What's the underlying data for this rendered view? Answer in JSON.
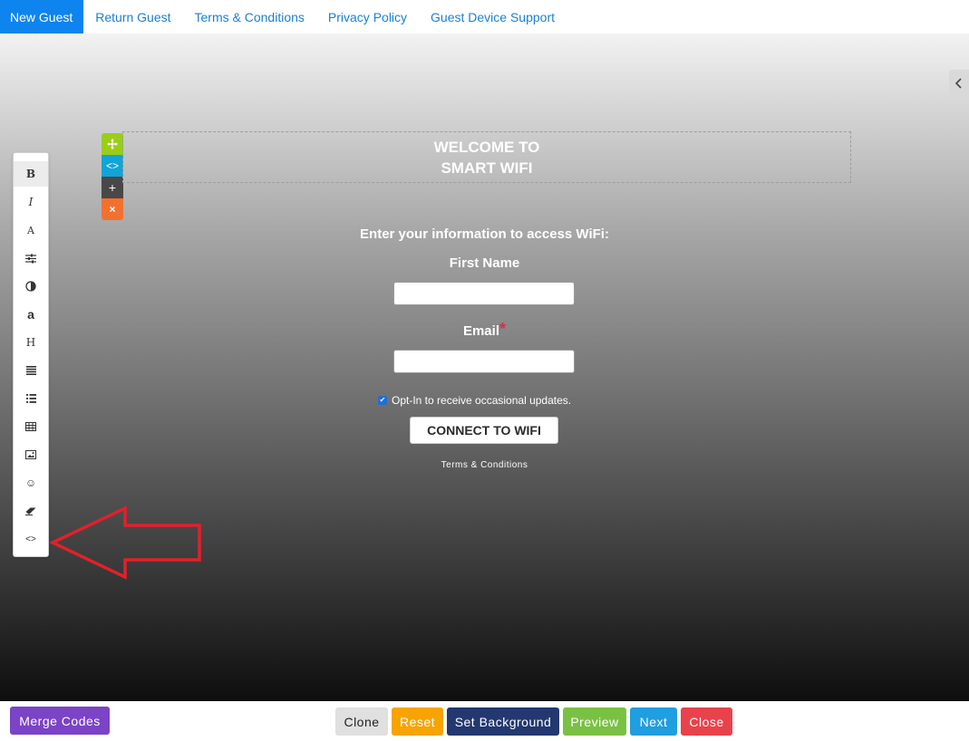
{
  "tabs": [
    {
      "label": "New Guest",
      "active": true
    },
    {
      "label": "Return Guest"
    },
    {
      "label": "Terms & Conditions"
    },
    {
      "label": "Privacy Policy"
    },
    {
      "label": "Guest Device Support"
    }
  ],
  "title": {
    "line1": "WELCOME TO",
    "line2": "SMART WIFI"
  },
  "form": {
    "prompt": "Enter your information to access WiFi:",
    "first_name_label": "First Name",
    "first_name_value": "",
    "email_label": "Email",
    "email_required_mark": "*",
    "email_value": "",
    "optin_label": "Opt-In to receive occasional updates.",
    "optin_checked": true,
    "connect_label": "CONNECT TO WIFI",
    "terms_label": "Terms & Conditions"
  },
  "block_controls": [
    "move-icon",
    "code-icon",
    "add-icon",
    "delete-icon"
  ],
  "toolbar_tools": [
    "bold",
    "italic",
    "font",
    "adjust",
    "contrast",
    "font-size",
    "heading",
    "align",
    "list",
    "table",
    "image",
    "emoji",
    "eraser",
    "code-view"
  ],
  "bottom_buttons": {
    "merge_codes": "Merge Codes",
    "clone": "Clone",
    "reset": "Reset",
    "set_background": "Set Background",
    "preview": "Preview",
    "next": "Next",
    "close": "Close"
  },
  "colors": {
    "active_tab": "#0d84ee",
    "merge": "#7b43c6",
    "clone": "#e0e0e0",
    "reset": "#f7a400",
    "set_background": "#233870",
    "preview": "#7ac143",
    "next": "#1f9ee0",
    "close": "#e9424b",
    "arrow": "#e3202a"
  }
}
